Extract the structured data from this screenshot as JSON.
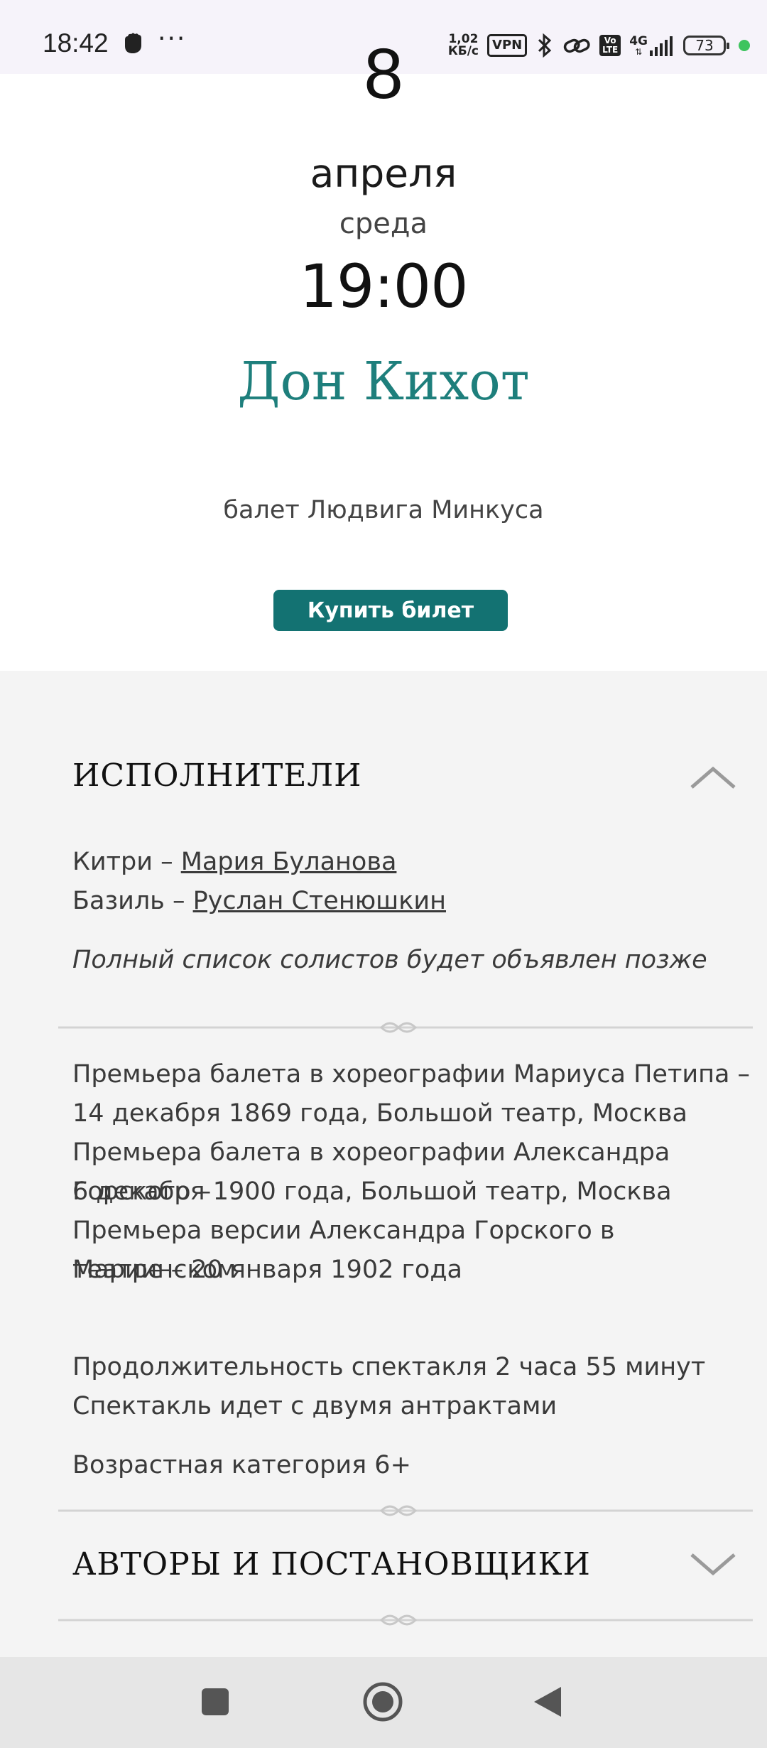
{
  "status_bar": {
    "time": "18:42",
    "more": "···",
    "speed_value": "1,02",
    "speed_unit": "КБ/c",
    "vpn": "VPN",
    "volte_top": "Vo",
    "volte_bottom": "LTE",
    "network": "4G",
    "battery": "73",
    "icons": [
      "fist-icon",
      "bluetooth-icon",
      "link-icon",
      "signal-icon",
      "battery-icon"
    ]
  },
  "event": {
    "day": "8",
    "month": "апреля",
    "weekday": "среда",
    "time": "19:00",
    "title": "Дон Кихот",
    "subtitle": "балет Людвига Минкуса",
    "buy_label": "Купить билет"
  },
  "performers": {
    "heading": "ИСПОЛНИТЕЛИ",
    "cast": [
      {
        "role": "Китри – ",
        "name": "Мария Буланова"
      },
      {
        "role": "Базиль – ",
        "name": "Руслан Стенюшкин"
      }
    ],
    "note": "Полный список солистов будет объявлен позже",
    "expanded": true
  },
  "history": [
    "Премьера балета в хореографии Мариуса Петипа –",
    "14 декабря 1869 года, Большой театр, Москва",
    "Премьера балета в хореографии Александра Горского –",
    "6 декабря 1900 года, Большой театр, Москва",
    "Премьера версии Александра Горского в Мариинском",
    "театре – 20 января 1902 года"
  ],
  "details": {
    "duration": "Продолжительность спектакля 2 часа 55 минут",
    "intermissions": "Спектакль идет с двумя антрактами",
    "age": "Возрастная категория 6+"
  },
  "authors": {
    "heading": "АВТОРЫ И ПОСТАНОВЩИКИ",
    "expanded": false
  },
  "nav_bar": {
    "buttons": [
      "recents-button",
      "home-button",
      "back-button"
    ]
  }
}
